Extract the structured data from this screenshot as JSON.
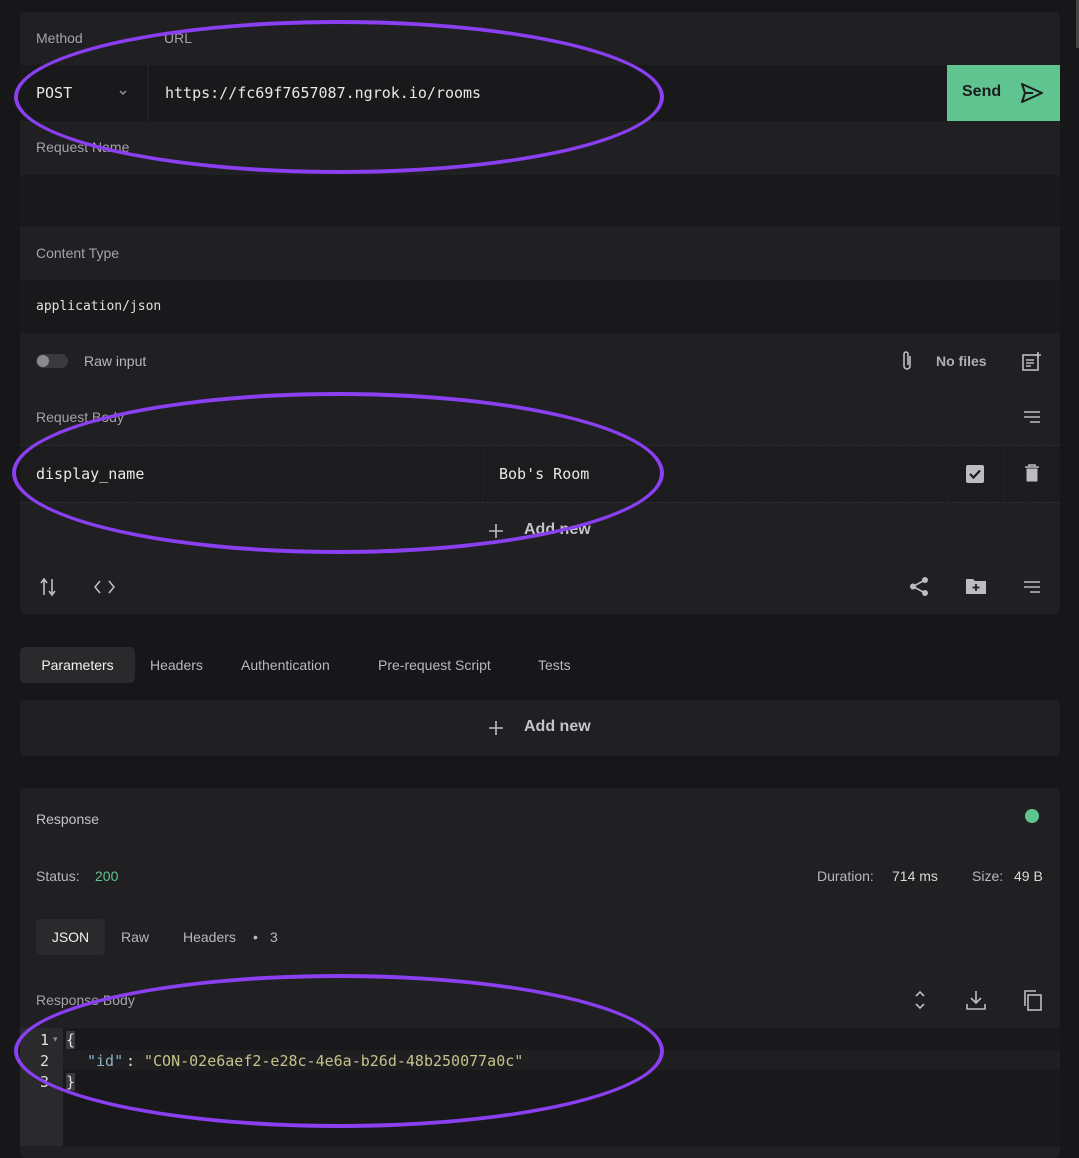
{
  "request": {
    "method_label": "Method",
    "url_label": "URL",
    "method": "POST",
    "url": "https://fc69f7657087.ngrok.io/rooms",
    "send_label": "Send",
    "request_name_label": "Request Name",
    "request_name_value": "",
    "content_type_label": "Content Type",
    "content_type_value": "application/json",
    "raw_input_label": "Raw input",
    "no_files_label": "No files",
    "request_body_label": "Request Body",
    "body_rows": [
      {
        "key": "display_name",
        "value": "Bob's Room",
        "enabled": true
      }
    ],
    "add_new_label": "Add new"
  },
  "tabs": {
    "items": [
      "Parameters",
      "Headers",
      "Authentication",
      "Pre-request Script",
      "Tests"
    ],
    "active": "Parameters",
    "add_new_label": "Add new"
  },
  "response": {
    "title": "Response",
    "status_label": "Status:",
    "status_value": "200",
    "duration_label": "Duration:",
    "duration_value": "714 ms",
    "size_label": "Size:",
    "size_value": "49 B",
    "view_tabs": [
      "JSON",
      "Raw",
      "Headers"
    ],
    "headers_count": "3",
    "headers_sep": "•",
    "body_label": "Response Body",
    "line_numbers": [
      "1",
      "2",
      "3"
    ],
    "code": {
      "open": "{",
      "key": "\"id\"",
      "colon": ":",
      "value": "\"CON-02e6aef2-e28c-4e6a-b26d-48b250077a0c\"",
      "close": "}"
    }
  },
  "colors": {
    "send_bg": "#5fc48f",
    "status_ok": "#5fc48f",
    "annotation": "#8a3ff0",
    "json_key": "#8ab4c8",
    "json_string": "#c7c28a"
  },
  "icons": [
    "chevron-down-icon",
    "send-icon",
    "paperclip-icon",
    "add-note-icon",
    "align-icon",
    "checkbox-icon",
    "trash-icon",
    "plus-icon",
    "sort-icon",
    "code-icon",
    "share-icon",
    "add-folder-icon",
    "expand-icon",
    "download-icon",
    "copy-icon",
    "status-dot-icon"
  ]
}
